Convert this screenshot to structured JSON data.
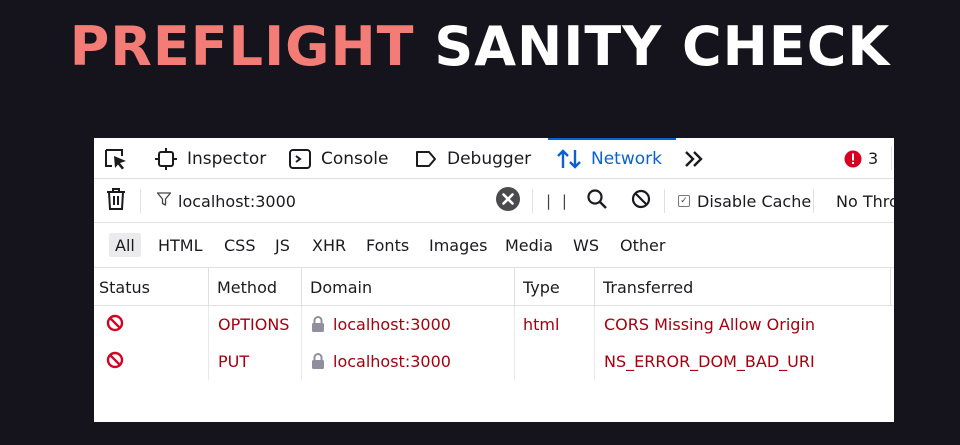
{
  "headline": {
    "word1": "PREFLIGHT",
    "word2": "SANITY CHECK"
  },
  "toolbar": {
    "inspector": "Inspector",
    "console": "Console",
    "debugger": "Debugger",
    "network": "Network",
    "error_count": "3"
  },
  "filterbar": {
    "filter_value": "localhost:3000",
    "pause_label": "| |",
    "disable_cache": "Disable Cache",
    "throttling": "No Thro"
  },
  "type_filters": [
    "All",
    "HTML",
    "CSS",
    "JS",
    "XHR",
    "Fonts",
    "Images",
    "Media",
    "WS",
    "Other"
  ],
  "table": {
    "headers": [
      "Status",
      "Method",
      "Domain",
      "Type",
      "Transferred"
    ],
    "rows": [
      {
        "method": "OPTIONS",
        "domain": "localhost:3000",
        "type": "html",
        "transferred": "CORS Missing Allow Origin"
      },
      {
        "method": "PUT",
        "domain": "localhost:3000",
        "type": "",
        "transferred": "NS_ERROR_DOM_BAD_URI"
      }
    ]
  },
  "colors": {
    "headline_accent": "#f47c76",
    "network_active": "#0a62d0",
    "error_red": "#d70022",
    "row_text": "#a4000f"
  }
}
